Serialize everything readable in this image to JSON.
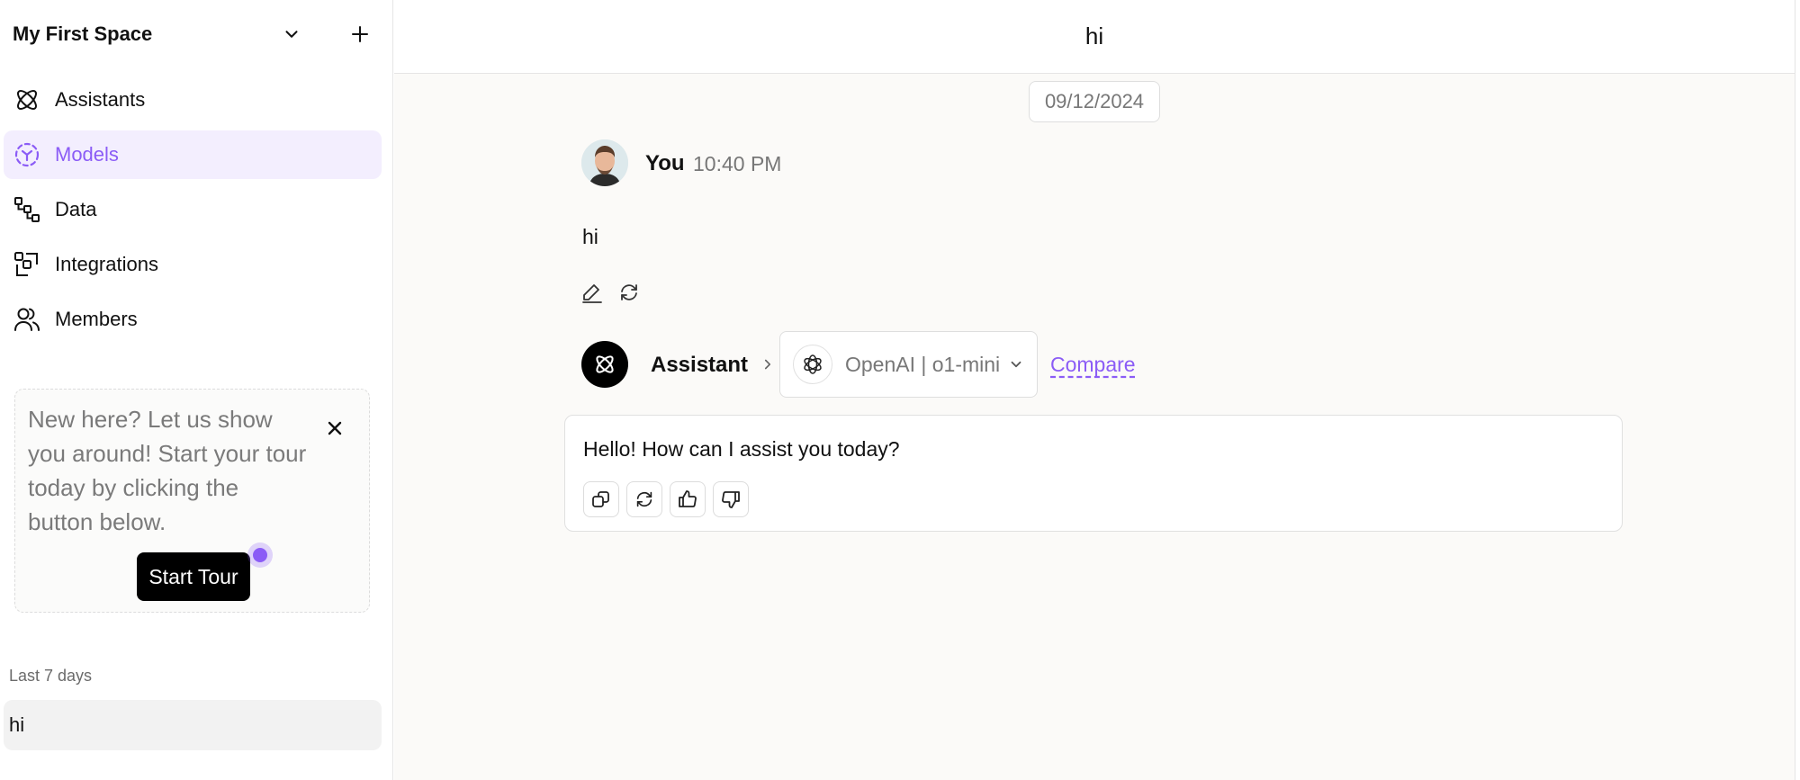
{
  "sidebar": {
    "space_title": "My First Space",
    "header_icons": {
      "dropdown": "chevron-down-icon",
      "add": "plus-icon"
    },
    "nav": [
      {
        "label": "Assistants",
        "icon": "atom-icon",
        "active": false
      },
      {
        "label": "Models",
        "icon": "dashed-cube-icon",
        "active": true
      },
      {
        "label": "Data",
        "icon": "data-tree-icon",
        "active": false
      },
      {
        "label": "Integrations",
        "icon": "integrations-icon",
        "active": false
      },
      {
        "label": "Members",
        "icon": "users-icon",
        "active": false
      }
    ],
    "tour": {
      "text": "New here? Let us show you around! Start your tour today by clicking the button below.",
      "button_label": "Start Tour"
    },
    "history_section_label": "Last 7 days",
    "history": [
      {
        "label": "hi"
      }
    ]
  },
  "chat": {
    "title": "hi",
    "date": "09/12/2024",
    "user": {
      "name": "You",
      "time": "10:40 PM",
      "message": "hi"
    },
    "assistant": {
      "name": "Assistant",
      "model_label": "OpenAI | o1-mini",
      "compare_label": "Compare",
      "reply": "Hello! How can I assist you today?"
    }
  },
  "colors": {
    "accent": "#8b5cf6",
    "active_bg": "#f3eefe",
    "main_bg": "#fbfaf8"
  }
}
